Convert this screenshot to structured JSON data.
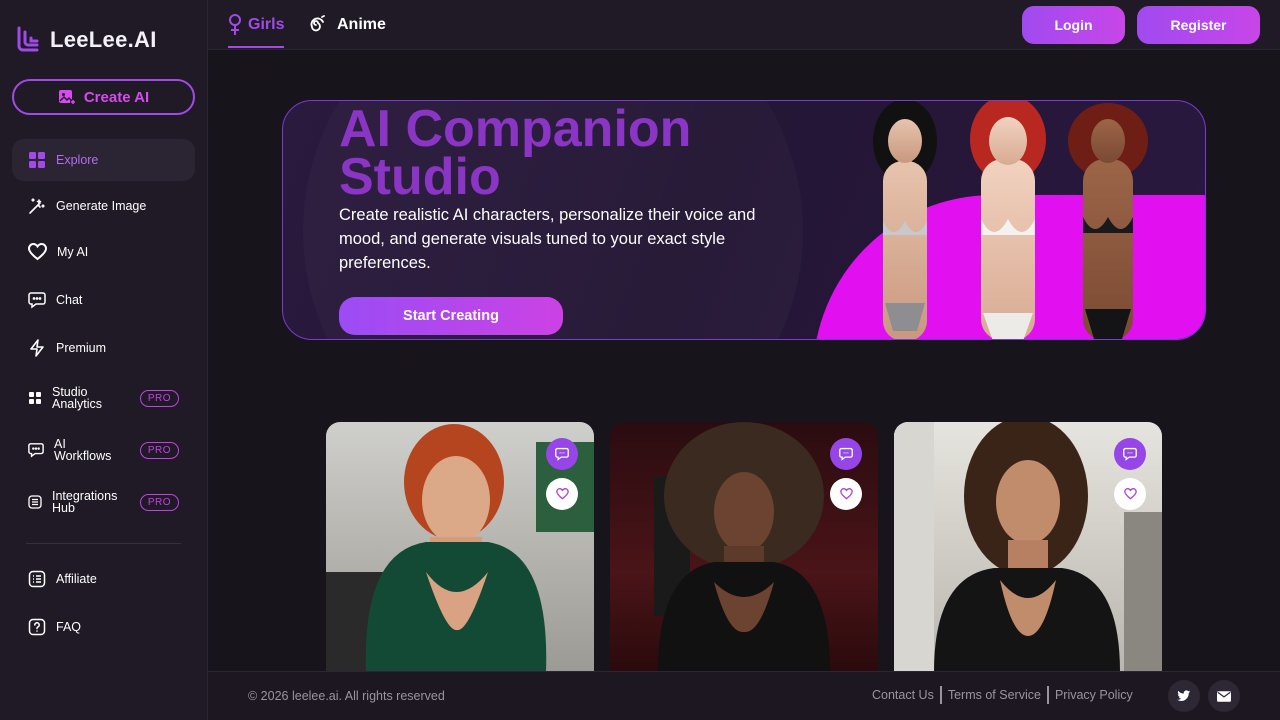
{
  "app": {
    "name": "LeeLee.AI",
    "brand_color": "#a24ae8",
    "accent_pink": "#d64af0"
  },
  "sidebar": {
    "create_label": "Create AI",
    "items": [
      {
        "label": "Explore",
        "icon": "grid-icon",
        "active": true
      },
      {
        "label": "Generate Image",
        "icon": "magic-wand-icon"
      },
      {
        "label": "My AI",
        "icon": "heart-icon"
      },
      {
        "label": "Chat",
        "icon": "chat-bubble-icon"
      },
      {
        "label": "Premium",
        "icon": "lightning-icon"
      },
      {
        "label": "Studio Analytics",
        "icon": "grid-small-icon",
        "badge": "PRO"
      },
      {
        "label": "AI Workflows",
        "icon": "chat-bubble-icon",
        "badge": "PRO"
      },
      {
        "label": "Integrations Hub",
        "icon": "list-icon",
        "badge": "PRO"
      }
    ],
    "bottom_items": [
      {
        "label": "Affiliate",
        "icon": "list-icon"
      },
      {
        "label": "FAQ",
        "icon": "question-icon"
      }
    ]
  },
  "header": {
    "tabs": [
      {
        "label": "Girls",
        "icon": "female-icon",
        "active": true
      },
      {
        "label": "Anime",
        "icon": "spiral-icon"
      }
    ],
    "login_label": "Login",
    "register_label": "Register"
  },
  "hero": {
    "title": "AI Companion Studio",
    "description": "Create realistic AI characters, personalize their voice and mood, and generate visuals tuned to your exact style preferences.",
    "cta_label": "Start Creating"
  },
  "cards": [
    {
      "name": "redhead-green-top",
      "chat_icon": "chat-bubble-icon",
      "like_icon": "heart-outline-icon"
    },
    {
      "name": "afro-black-top",
      "chat_icon": "chat-bubble-icon",
      "like_icon": "heart-outline-icon"
    },
    {
      "name": "brunette-leather-jacket",
      "chat_icon": "chat-bubble-icon",
      "like_icon": "heart-outline-icon"
    }
  ],
  "footer": {
    "copyright": "© 2026 leelee.ai. All rights reserved",
    "links": [
      "Contact Us",
      "Terms of Service",
      "Privacy Policy"
    ],
    "social": [
      "twitter-icon",
      "mail-icon"
    ]
  }
}
